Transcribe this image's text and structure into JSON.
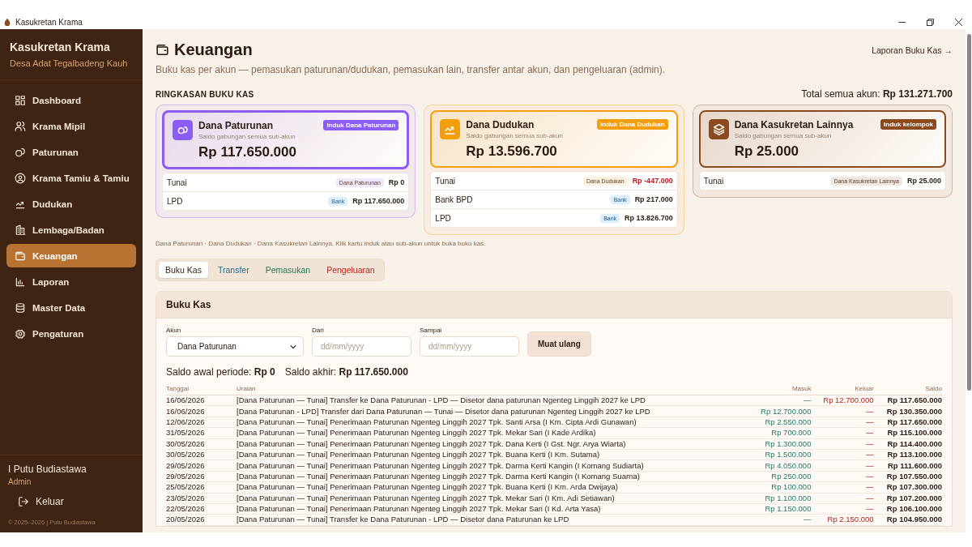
{
  "window": {
    "title": "Kasukretan Krama"
  },
  "sidebar": {
    "app_name": "Kasukretan Krama",
    "subtitle": "Desa Adat Tegalbadeng Kauh",
    "items": [
      {
        "label": "Dashboard",
        "selected": false
      },
      {
        "label": "Krama Mipil",
        "selected": false
      },
      {
        "label": "Paturunan",
        "selected": false
      },
      {
        "label": "Krama Tamiu & Tamiu",
        "selected": false
      },
      {
        "label": "Dudukan",
        "selected": false
      },
      {
        "label": "Lembaga/Badan",
        "selected": false
      },
      {
        "label": "Keuangan",
        "selected": true
      },
      {
        "label": "Laporan",
        "selected": false
      },
      {
        "label": "Master Data",
        "selected": false
      },
      {
        "label": "Pengaturan",
        "selected": false
      }
    ],
    "user": {
      "name": "I Putu Budiastawa",
      "role": "Admin"
    },
    "logout": "Keluar",
    "footer": "© 2025–2026 | Putu Budiastawa"
  },
  "page": {
    "title": "Keuangan",
    "description": "Buku kas per akun — pemasukan paturunan/dudukan, pemasukan lain, transfer antar akun, dan pengeluaran (admin).",
    "report_link": "Laporan Buku Kas →"
  },
  "summary": {
    "heading": "RINGKASAN BUKU KAS",
    "total_label": "Total semua akun:",
    "total_value": "Rp 131.271.700",
    "groups": [
      {
        "name": "Dana Paturunan",
        "caption": "Saldo gabungan semua sub-akun",
        "badge": "Induk Dana Paturunan",
        "amount": "Rp 117.650.000",
        "color": "#8b5cf6",
        "selected": true,
        "accounts": [
          {
            "name": "Tunai",
            "tag": "Dana Paturunan",
            "kind": "fund",
            "amount": "Rp 0",
            "negative": false
          },
          {
            "name": "LPD",
            "tag": "Bank",
            "kind": "bank",
            "amount": "Rp 117.650.000",
            "negative": false
          }
        ]
      },
      {
        "name": "Dana Dudukan",
        "caption": "Saldo gabungan semua sub-akun",
        "badge": "Induk Dana Dudukan",
        "amount": "Rp 13.596.700",
        "color": "#f59e0b",
        "selected": false,
        "accounts": [
          {
            "name": "Tunai",
            "tag": "Dana Dudukan",
            "kind": "fund",
            "amount": "Rp -447.000",
            "negative": true
          },
          {
            "name": "Bank BPD",
            "tag": "Bank",
            "kind": "bank",
            "amount": "Rp 217.000",
            "negative": false
          },
          {
            "name": "LPD",
            "tag": "Bank",
            "kind": "bank",
            "amount": "Rp 13.826.700",
            "negative": false
          }
        ]
      },
      {
        "name": "Dana Kasukretan Lainnya",
        "caption": "Saldo gabungan semua sub-akun",
        "badge": "Induk kelompok",
        "amount": "Rp 25.000",
        "color": "#8b4a1e",
        "selected": false,
        "accounts": [
          {
            "name": "Tunai",
            "tag": "Dana Kasukretan Lainnya",
            "kind": "fund",
            "amount": "Rp 25.000",
            "negative": false
          }
        ]
      }
    ],
    "note": "Dana Paturunan · Dana Dudukan · Dana Kasukretan Lainnya. Klik kartu induk atau sub-akun untuk buka buku kas."
  },
  "tabs": [
    {
      "label": "Buku Kas",
      "selected": true,
      "color": "#3b2414"
    },
    {
      "label": "Transfer",
      "selected": false,
      "color": "#1f6f8b"
    },
    {
      "label": "Pemasukan",
      "selected": false,
      "color": "#1e7a5a"
    },
    {
      "label": "Pengeluaran",
      "selected": false,
      "color": "#b3261e"
    }
  ],
  "ledger": {
    "title": "Buku Kas",
    "filters": {
      "account_label": "Akun",
      "account_value": "Dana Paturunan",
      "from_label": "Dari",
      "from_placeholder": "dd/mm/yyyy",
      "to_label": "Sampai",
      "to_placeholder": "dd/mm/yyyy",
      "reload": "Muat ulang"
    },
    "opening_label": "Saldo awal periode:",
    "opening_value": "Rp 0",
    "closing_label": "Saldo akhir:",
    "closing_value": "Rp 117.650.000",
    "columns": [
      "Tanggal",
      "Uraian",
      "Masuk",
      "Keluar",
      "Saldo"
    ],
    "rows": [
      [
        "16/06/2026",
        "[Dana Paturunan — Tunai] Transfer ke Dana Paturunan - LPD — Disetor dana paturunan Ngenteg Linggih 2027 ke LPD",
        "—",
        "Rp 12.700.000",
        "Rp 117.650.000"
      ],
      [
        "16/06/2026",
        "[Dana Paturunan - LPD] Transfer dari Dana Paturunan — Tunai — Disetor dana paturunan Ngenteg Linggih 2027 ke LPD",
        "Rp 12.700.000",
        "—",
        "Rp 130.350.000"
      ],
      [
        "12/06/2026",
        "[Dana Paturunan — Tunai] Penerimaan Paturunan Ngenteg Linggih 2027 Tpk. Santi Arsa (I Km. Cipta Ardi Gunawan)",
        "Rp 2.550.000",
        "—",
        "Rp 117.650.000"
      ],
      [
        "31/05/2026",
        "[Dana Paturunan — Tunai] Penerimaan Paturunan Ngenteg Linggih 2027 Tpk. Mekar Sari (I Kade Ardika)",
        "Rp 700.000",
        "—",
        "Rp 115.100.000"
      ],
      [
        "30/05/2026",
        "[Dana Paturunan — Tunai] Penerimaan Paturunan Ngenteg Linggih 2027 Tpk. Dana Kerti (I Gst. Ngr. Arya Wiarta)",
        "Rp 1.300.000",
        "—",
        "Rp 114.400.000"
      ],
      [
        "30/05/2026",
        "[Dana Paturunan — Tunai] Penerimaan Paturunan Ngenteg Linggih 2027 Tpk. Buana Kerti (I Km. Sutama)",
        "Rp 1.500.000",
        "—",
        "Rp 113.100.000"
      ],
      [
        "29/05/2026",
        "[Dana Paturunan — Tunai] Penerimaan Paturunan Ngenteg Linggih 2027 Tpk. Darma Kerti Kangin (I Komang Sudiarta)",
        "Rp 4.050.000",
        "—",
        "Rp 111.600.000"
      ],
      [
        "29/05/2026",
        "[Dana Paturunan — Tunai] Penerimaan Paturunan Ngenteg Linggih 2027 Tpk. Darma Kerti Kangin (I Komang Suarna)",
        "Rp 250.000",
        "—",
        "Rp 107.550.000"
      ],
      [
        "25/05/2026",
        "[Dana Paturunan — Tunai] Penerimaan Paturunan Ngenteg Linggih 2027 Tpk. Buana Kerti (I Km. Arda Dwijaya)",
        "Rp 100.000",
        "—",
        "Rp 107.300.000"
      ],
      [
        "23/05/2026",
        "[Dana Paturunan — Tunai] Penerimaan Paturunan Ngenteg Linggih 2027 Tpk. Mekar Sari (I Km. Adi Setiawan)",
        "Rp 1.100.000",
        "—",
        "Rp 107.200.000"
      ],
      [
        "22/05/2026",
        "[Dana Paturunan — Tunai] Penerimaan Paturunan Ngenteg Linggih 2027 Tpk. Mekar Sari (I Kd. Arta Yasa)",
        "Rp 1.150.000",
        "—",
        "Rp 106.100.000"
      ],
      [
        "20/05/2026",
        "[Dana Paturunan — Tunai] Transfer ke Dana Paturunan - LPD — Disetor dana Paturunan ke LPD",
        "—",
        "Rp 2.150.000",
        "Rp 104.950.000"
      ]
    ]
  }
}
